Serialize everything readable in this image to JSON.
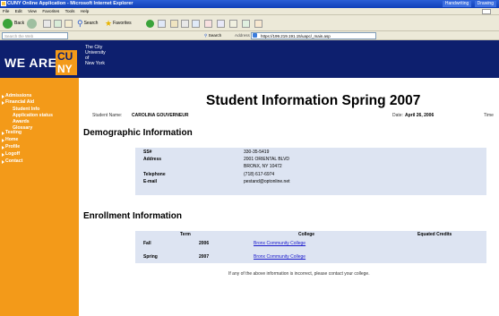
{
  "window": {
    "title": "CUNY Online Application - Microsoft Internet Explorer",
    "right_items": [
      "Handwriting",
      "Drawing"
    ]
  },
  "menu": [
    "File",
    "Edit",
    "View",
    "Favorites",
    "Tools",
    "Help"
  ],
  "toolbar": {
    "back_label": "Back",
    "search_label": "Search",
    "favorites_label": "Favorites"
  },
  "addressbar": {
    "search_placeholder": "Search the Web",
    "search_label": "Search",
    "address_label": "Address",
    "url": "https://199.219.191.15/uapc/_main.asp"
  },
  "header": {
    "tagline": "WE ARE",
    "logo_top": "CU",
    "logo_bottom": "NY",
    "university_lines": [
      "The City",
      "University",
      "of",
      "New York"
    ]
  },
  "nav": {
    "items": [
      {
        "label": "Admissions",
        "type": "top"
      },
      {
        "label": "Financial Aid",
        "type": "top"
      },
      {
        "label": "Student Info",
        "type": "sub"
      },
      {
        "label": "Application status",
        "type": "sub"
      },
      {
        "label": "Awards",
        "type": "sub"
      },
      {
        "label": "Glossary",
        "type": "sub"
      },
      {
        "label": "Testing",
        "type": "top"
      },
      {
        "label": "Home",
        "type": "top"
      },
      {
        "label": "Profile",
        "type": "top"
      },
      {
        "label": "Logoff",
        "type": "top"
      },
      {
        "label": "Contact",
        "type": "top"
      }
    ]
  },
  "page": {
    "title": "Student Information Spring 2007",
    "student_name_label": "Student Name:",
    "student_name": "CAROLINA GOUVERNEUR",
    "date_label": "Date:",
    "date": "April 26, 2006",
    "time_label": "Time"
  },
  "demographic": {
    "heading": "Demographic Information",
    "ssn_label": "SS#",
    "ssn": "330-35-5419",
    "address_label": "Address",
    "address_line1": "2001 ORIENTAL BLVD",
    "address_line2": "BRONX, NY 10472",
    "telephone_label": "Telephone",
    "telephone": "(718) 617-6974",
    "email_label": "E-mail",
    "email": "pestand@optonline.net"
  },
  "enrollment": {
    "heading": "Enrollment Information",
    "columns": [
      "Term",
      "College",
      "Equated Credits"
    ],
    "rows": [
      {
        "term": "Fall",
        "year": "2006",
        "college": "Bronx Community College"
      },
      {
        "term": "Spring",
        "year": "2007",
        "college": "Bronx Community College"
      }
    ]
  },
  "note": "If any of the above information is incorrect, please contact your college."
}
